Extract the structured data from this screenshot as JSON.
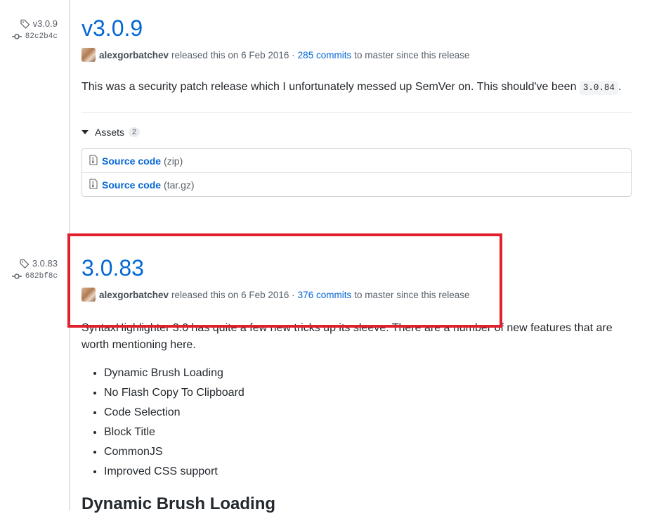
{
  "colors": {
    "link": "#0366d6",
    "highlight": "#e0202d",
    "muted": "#586069"
  },
  "release1": {
    "tag": "v3.0.9",
    "commit": "82c2b4c",
    "title": "v3.0.9",
    "author": "alexgorbatchev",
    "released_text": "released this on 6 Feb 2016 ·",
    "commits_link": "285 commits",
    "commits_suffix": "to master since this release",
    "description_text": "This was a security patch release which I unfortunately messed up SemVer on. This should've been",
    "description_code": "3.0.84",
    "description_end": ".",
    "assets_label": "Assets",
    "assets_count": "2",
    "assets": [
      {
        "name": "Source code",
        "ext": "(zip)"
      },
      {
        "name": "Source code",
        "ext": "(tar.gz)"
      }
    ]
  },
  "release2": {
    "tag": "3.0.83",
    "commit": "682bf8c",
    "title": "3.0.83",
    "author": "alexgorbatchev",
    "released_text": "released this on 6 Feb 2016 ·",
    "commits_link": "376 commits",
    "commits_suffix": "to master since this release",
    "description": "SyntaxHighlighter 3.0 has quite a few new tricks up its sleeve. There are a number of new features that are worth mentioning here.",
    "features": [
      "Dynamic Brush Loading",
      "No Flash Copy To Clipboard",
      "Code Selection",
      "Block Title",
      "CommonJS",
      "Improved CSS support"
    ],
    "section_heading": "Dynamic Brush Loading"
  }
}
